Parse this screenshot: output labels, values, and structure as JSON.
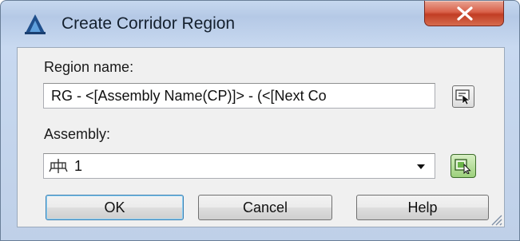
{
  "dialog": {
    "title": "Create Corridor Region",
    "close_symbol": "X",
    "app_icon": "civil3d-logo-icon"
  },
  "region": {
    "label": "Region name:",
    "value": "RG - <[Assembly Name(CP)]> - (<[Next Co",
    "pick_icon": "edit-name-template-icon"
  },
  "assembly": {
    "label": "Assembly:",
    "selected": "1",
    "item_icon": "assembly-icon",
    "pick_icon": "select-from-drawing-icon"
  },
  "buttons": {
    "ok": "OK",
    "cancel": "Cancel",
    "help": "Help"
  },
  "colors": {
    "title_bar": "#c6d8ef",
    "close_button": "#c94a32",
    "client_area": "#f0f0f0",
    "default_button_border": "#3c7fb1"
  }
}
